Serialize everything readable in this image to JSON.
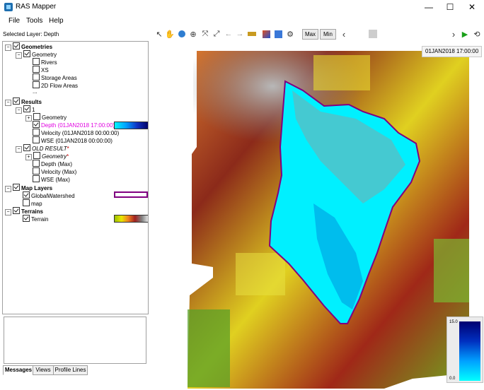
{
  "window": {
    "title": "RAS Mapper",
    "min_symbol": "—",
    "max_symbol": "☐",
    "close_symbol": "✕"
  },
  "menu": {
    "file": "File",
    "tools": "Tools",
    "help": "Help"
  },
  "toolbar": {
    "selected_layer": "Selected Layer: Depth",
    "max_label": "Max",
    "min_label": "Min",
    "prev_symbol": "‹",
    "next_symbol": "›",
    "play_symbol": "▶",
    "reset_symbol": "⟲"
  },
  "tree": {
    "geometries": {
      "label": "Geometries",
      "geometry": "Geometry",
      "rivers": "Rivers",
      "xs": "XS",
      "storage_areas": "Storage Areas",
      "flow_areas": "2D Flow Areas",
      "ellipsis": "..."
    },
    "results": {
      "label": "Results",
      "plan": "1",
      "geometry": "Geometry",
      "depth": "Depth (01JAN2018 17:00:00)",
      "velocity": "Velocity (01JAN2018 00:00:00)",
      "wse": "WSE (01JAN2018 00:00:00)"
    },
    "old_result": {
      "label": "OLD RESULT",
      "marker": "*",
      "geometry": "Geometry",
      "geometry_marker": "*",
      "depth": "Depth (Max)",
      "velocity": "Velocity (Max)",
      "wse": "WSE (Max)"
    },
    "map_layers": {
      "label": "Map Layers",
      "watershed": "GlobalWatershed",
      "map": "map"
    },
    "terrains": {
      "label": "Terrains",
      "terrain": "Terrain"
    }
  },
  "tabs": {
    "messages": "Messages",
    "views": "Views",
    "profile_lines": "Profile Lines"
  },
  "map": {
    "time_label": "01JAN2018 17:00:00",
    "colorbar_max": "15.0",
    "colorbar_min": "0.0"
  },
  "colors": {
    "watershed": "#800080",
    "depth_shallow": "#00f5ff",
    "depth_deep": "#000070",
    "selected_text": "#e000e0"
  }
}
